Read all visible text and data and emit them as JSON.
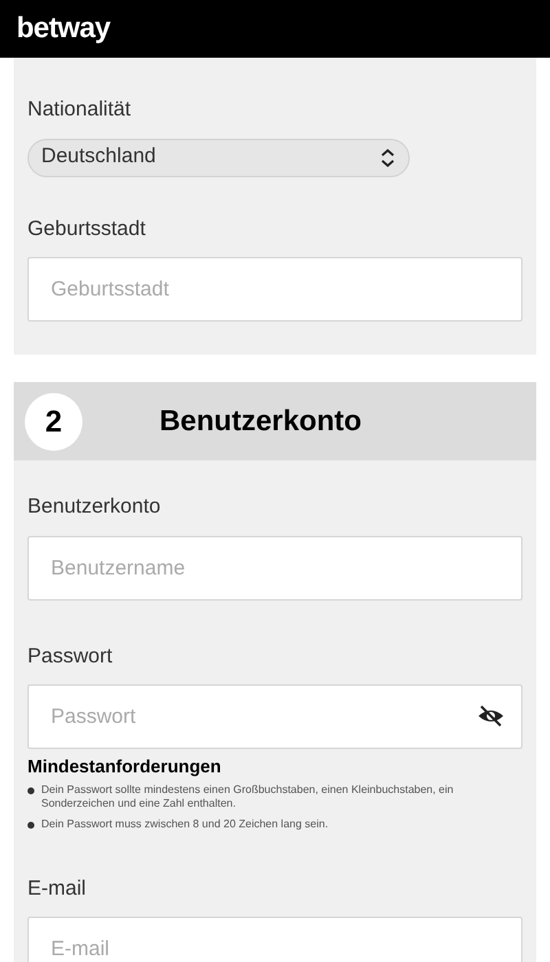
{
  "header": {
    "logo": "betway"
  },
  "section_1": {
    "nationality": {
      "label": "Nationalität",
      "value": "Deutschland"
    },
    "birthplace": {
      "label": "Geburtsstadt",
      "placeholder": "Geburtsstadt"
    }
  },
  "section_2": {
    "step": "2",
    "title": "Benutzerkonto",
    "username": {
      "label": "Benutzerkonto",
      "placeholder": "Benutzername"
    },
    "password": {
      "label": "Passwort",
      "placeholder": "Passwort"
    },
    "requirements": {
      "title": "Mindestanforderungen",
      "items": [
        "Dein Passwort sollte mindestens einen Großbuchstaben, einen Kleinbuchstaben, ein Sonderzeichen und eine Zahl enthalten.",
        "Dein Passwort muss zwischen 8 und 20 Zeichen lang sein."
      ]
    },
    "email": {
      "label": "E-mail",
      "placeholder": "E-mail"
    }
  }
}
